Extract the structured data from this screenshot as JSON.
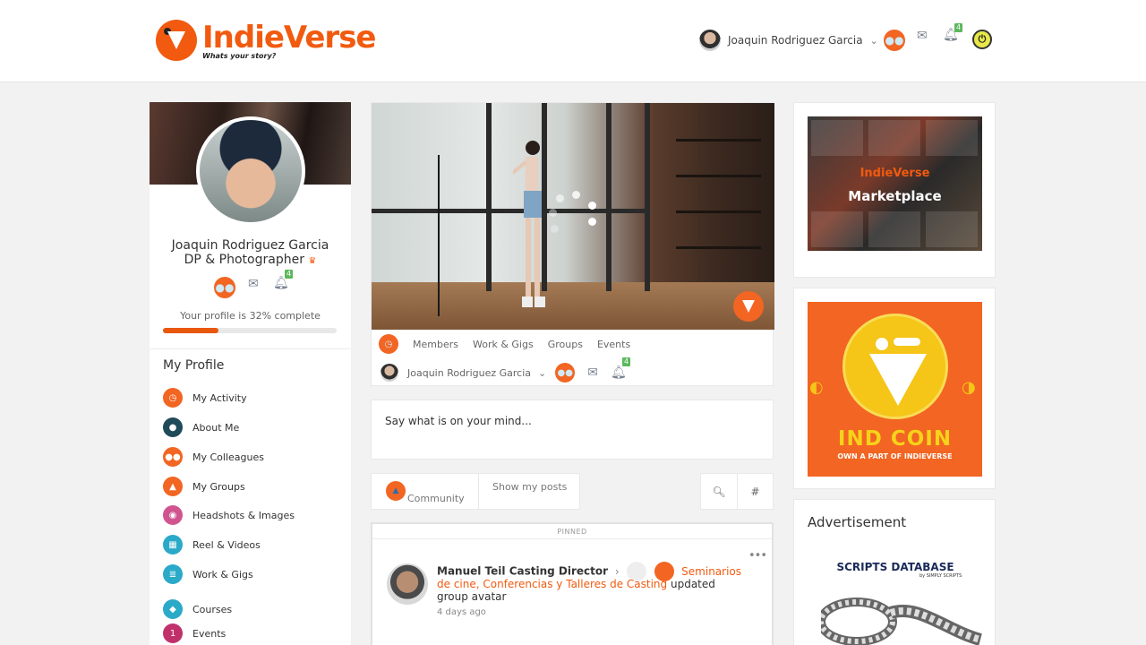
{
  "brand": {
    "name": "IndieVerse",
    "tagline": "Whats your story?",
    "accent": "#f15a0f"
  },
  "header": {
    "user_name": "Joaquin Rodriguez Garcia",
    "notifications_count": "4"
  },
  "profile": {
    "name": "Joaquin Rodriguez Garcia",
    "role": "DP & Photographer",
    "notifications_count": "4",
    "progress_text": "Your profile is 32% complete",
    "progress": 0.32,
    "section_title": "My Profile",
    "menu": [
      {
        "label": "My Activity",
        "icon": "activity-icon",
        "color": "#f26522"
      },
      {
        "label": "About Me",
        "icon": "about-me-icon",
        "color": "#1f4a5a"
      },
      {
        "label": "My Colleagues",
        "icon": "colleagues-icon",
        "color": "#f26522"
      },
      {
        "label": "My Groups",
        "icon": "groups-icon",
        "color": "#f26522"
      },
      {
        "label": "Headshots & Images",
        "icon": "camera-icon",
        "color": "#d0558f"
      },
      {
        "label": "Reel & Videos",
        "icon": "film-icon",
        "color": "#2aa9c9"
      },
      {
        "label": "Work & Gigs",
        "icon": "work-icon",
        "color": "#2aa9c9"
      },
      {
        "label": "Courses",
        "icon": "courses-icon",
        "color": "#2aa9c9"
      },
      {
        "label": "Events",
        "icon": "calendar-icon",
        "color": "#c0306a"
      }
    ]
  },
  "hero_nav": {
    "links": [
      "Members",
      "Work & Gigs",
      "Groups",
      "Events"
    ],
    "user_name": "Joaquin Rodriguez Garcia",
    "notifications_count": "4"
  },
  "composer": {
    "placeholder": "Say what is on your mind..."
  },
  "feed_tabs": {
    "community": "Community",
    "show_my_posts": "Show my posts"
  },
  "pinned_post": {
    "label": "PINNED",
    "author": "Manuel Teil Casting Director",
    "group_line1": "Seminarios",
    "group_line2": "de cine, Conferencias y Talleres de Casting",
    "action": "updated",
    "action_line2": "group avatar",
    "time": "4 days ago"
  },
  "sidebar_right": {
    "marketplace_logo": "IndieVerse",
    "marketplace_title": "Marketplace",
    "coin_title": "IND COIN",
    "coin_subtitle": "OWN A PART OF INDIEVERSE",
    "ad_title": "Advertisement",
    "ad_brand": "SCRIPTS DATABASE",
    "ad_brand_sub": "by SIMPLY SCRIPTS"
  }
}
